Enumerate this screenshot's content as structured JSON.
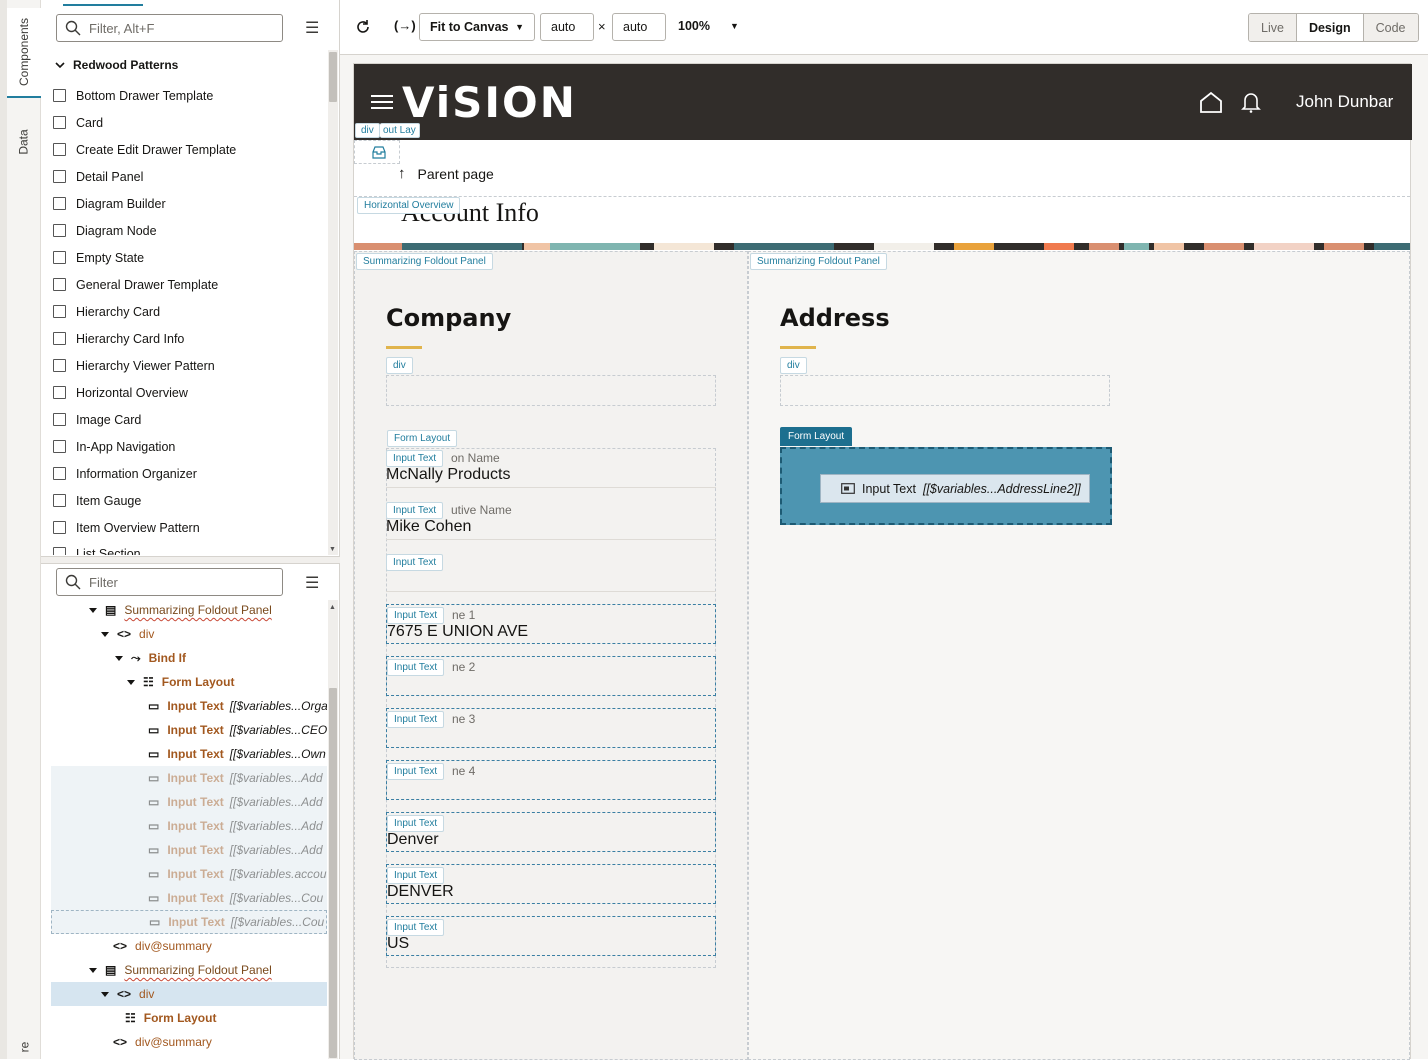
{
  "vertical_tabs": {
    "components": "Components",
    "data": "Data",
    "bottom": "re"
  },
  "component_filter": {
    "placeholder": "Filter, Alt+F"
  },
  "component_group": {
    "title": "Redwood Patterns"
  },
  "components": [
    "Bottom Drawer Template",
    "Card",
    "Create Edit Drawer Template",
    "Detail Panel",
    "Diagram Builder",
    "Diagram Node",
    "Empty State",
    "General Drawer Template",
    "Hierarchy Card",
    "Hierarchy Card Info",
    "Hierarchy Viewer Pattern",
    "Horizontal Overview",
    "Image Card",
    "In-App Navigation",
    "Information Organizer",
    "Item Gauge",
    "Item Overview Pattern",
    "List Section"
  ],
  "structure_filter": {
    "placeholder": "Filter"
  },
  "tree": [
    {
      "label": "Summarizing Foldout Panel",
      "kind": "panel"
    },
    {
      "label": "div",
      "kind": "div"
    },
    {
      "label": "Bind If",
      "kind": "bindif"
    },
    {
      "label": "Form Layout",
      "kind": "form"
    },
    {
      "label": "Input Text",
      "expr": "[[$variables...Orga",
      "kind": "input"
    },
    {
      "label": "Input Text",
      "expr": "[[$variables...CEO",
      "kind": "input"
    },
    {
      "label": "Input Text",
      "expr": "[[$variables...Own",
      "kind": "input"
    },
    {
      "label": "Input Text",
      "expr": "[[$variables...Add",
      "kind": "input-faded"
    },
    {
      "label": "Input Text",
      "expr": "[[$variables...Add",
      "kind": "input-faded"
    },
    {
      "label": "Input Text",
      "expr": "[[$variables...Add",
      "kind": "input-faded"
    },
    {
      "label": "Input Text",
      "expr": "[[$variables...Add",
      "kind": "input-faded"
    },
    {
      "label": "Input Text",
      "expr": "[[$variables.accou",
      "kind": "input-faded"
    },
    {
      "label": "Input Text",
      "expr": "[[$variables...Cou",
      "kind": "input-faded"
    },
    {
      "label": "Input Text",
      "expr": "[[$variables...Cou",
      "kind": "input-faded"
    },
    {
      "label": "div@summary",
      "kind": "divsum"
    },
    {
      "label": "Summarizing Foldout Panel",
      "kind": "panel"
    },
    {
      "label": "div",
      "kind": "div-selected"
    },
    {
      "label": "Form Layout",
      "kind": "form"
    },
    {
      "label": "div@summary",
      "kind": "divsum"
    }
  ],
  "toolbar": {
    "fit": "Fit to Canvas",
    "width": "auto",
    "times": "×",
    "height": "auto",
    "zoom": "100%",
    "modes": [
      "Live",
      "Design",
      "Code"
    ],
    "active_mode": "Design"
  },
  "app": {
    "logo": "ViSION",
    "user": "John Dunbar",
    "parent_link": "Parent page",
    "page_title": "Account Info"
  },
  "chips": {
    "div": "div",
    "out_lay": "out Lay",
    "horizontal_overview": "Horizontal Overview",
    "sfp": "Summarizing Foldout Panel",
    "form_layout": "Form Layout",
    "input_text": "Input Text"
  },
  "company": {
    "title": "Company",
    "fields": [
      {
        "label": "on Name",
        "value": "McNally Products"
      },
      {
        "label": "utive Name",
        "value": "Mike Cohen"
      },
      {
        "label": "",
        "value": ""
      },
      {
        "label": "ne 1",
        "value": "7675 E UNION AVE"
      },
      {
        "label": "ne 2",
        "value": ""
      },
      {
        "label": "ne 3",
        "value": ""
      },
      {
        "label": "ne 4",
        "value": ""
      },
      {
        "label": "",
        "value": "Denver"
      },
      {
        "label": "",
        "value": "DENVER"
      },
      {
        "label": "",
        "value": "US"
      }
    ]
  },
  "address": {
    "title": "Address",
    "selected_component": "Input Text",
    "selected_expr": "[[$variables...AddressLine2]]"
  }
}
